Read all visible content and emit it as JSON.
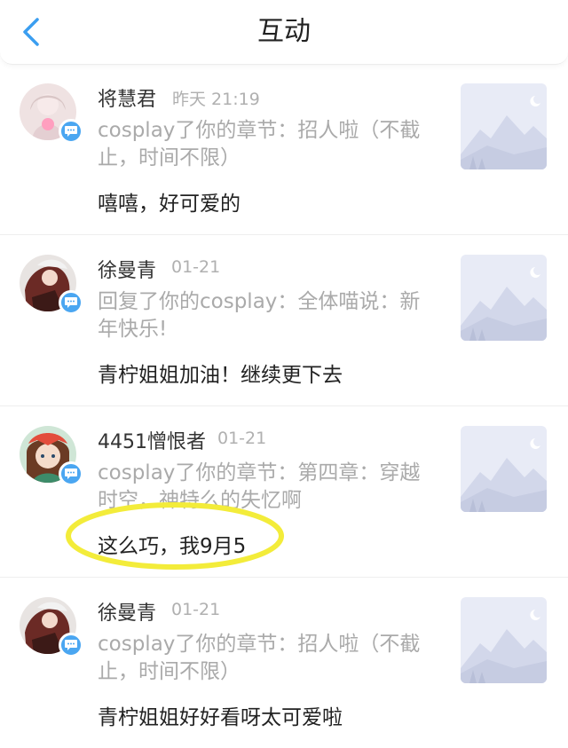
{
  "header": {
    "title": "互动"
  },
  "items": [
    {
      "name": "将慧君",
      "time": "昨天 21:19",
      "action": "cosplay了你的章节：招人啦（不截止，时间不限）",
      "reply": "嘻嘻，好可爱的",
      "avatar_color": "#e9d6d6"
    },
    {
      "name": "徐曼青",
      "time": "01-21",
      "action": "回复了你的cosplay：全体喵说：新年快乐!",
      "reply": "青柠姐姐加油！继续更下去",
      "avatar_color": "#6b2a25"
    },
    {
      "name": "4451憎恨者",
      "time": "01-21",
      "action": "cosplay了你的章节：第四章：穿越时空，神特么的失忆啊",
      "reply": "这么巧，我9月5",
      "avatar_color": "#5a8a6a"
    },
    {
      "name": "徐曼青",
      "time": "01-21",
      "action": "cosplay了你的章节：招人啦（不截止，时间不限）",
      "reply": "青柠姐姐好好看呀太可爱啦",
      "avatar_color": "#6b2a25"
    }
  ],
  "colors": {
    "accent": "#4aa6f1",
    "highlight": "#f3ec3a",
    "thumb_bg": "#e8ebf6"
  }
}
